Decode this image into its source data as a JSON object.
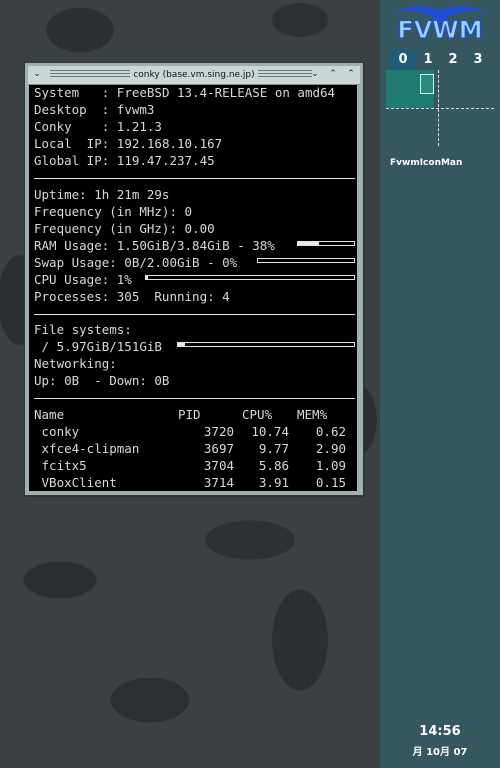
{
  "conky": {
    "title": "conky (base.vm.sing.ne.jp)",
    "system_label": "System   : ",
    "system_value": "FreeBSD 13.4-RELEASE on amd64",
    "desktop_label": "Desktop  : ",
    "desktop_value": "fvwm3",
    "conky_label": "Conky    : ",
    "conky_value": "1.21.3",
    "local_ip_label": "Local  IP: ",
    "local_ip_value": "192.168.10.167",
    "global_ip_label": "Global IP: ",
    "global_ip_value": "119.47.237.45",
    "uptime": "Uptime: 1h 21m 29s",
    "freq_mhz": "Frequency (in MHz): 0",
    "freq_ghz": "Frequency (in GHz): 0.00",
    "ram_text": "RAM Usage: 1.50GiB/3.84GiB - 38%",
    "ram_percent": 38,
    "swap_text": "Swap Usage: 0B/2.00GiB - 0%",
    "swap_percent": 0,
    "cpu_text": "CPU Usage: 1%",
    "cpu_percent": 1,
    "processes_text": "Processes: 305  Running: 4",
    "filesystems_label": "File systems:",
    "fs_text": " / 5.97GiB/151GiB",
    "fs_percent": 4,
    "networking_label": "Networking:",
    "net_text": "Up: 0B  - Down: 0B",
    "table": {
      "headers": [
        "Name",
        "PID",
        "CPU%",
        "MEM%"
      ],
      "rows": [
        {
          "name": " conky",
          "pid": "3720",
          "cpu": "10.74",
          "mem": "0.62"
        },
        {
          "name": " xfce4-clipman",
          "pid": "3697",
          "cpu": "9.77",
          "mem": "2.90"
        },
        {
          "name": " fcitx5",
          "pid": "3704",
          "cpu": "5.86",
          "mem": "1.09"
        },
        {
          "name": " VBoxClient",
          "pid": "3714",
          "cpu": "3.91",
          "mem": "0.15"
        }
      ]
    }
  },
  "pager": {
    "logo_text": "FVWM",
    "desks": [
      "0",
      "1",
      "2",
      "3"
    ],
    "active_desk": "0",
    "iconman_label": "FvwmIconMan"
  },
  "clock": {
    "time": "14:56",
    "date": "月 10月 07"
  },
  "colors": {
    "panel": "#36575f",
    "active_desk": "#1e5c7a",
    "logo": "#1f4fd0"
  }
}
